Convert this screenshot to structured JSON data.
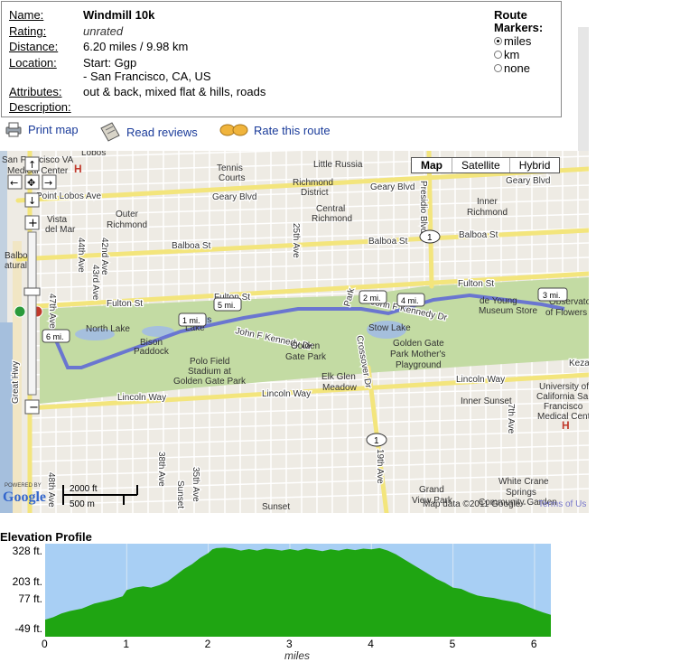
{
  "route": {
    "labels": {
      "name": "Name:",
      "rating": "Rating:",
      "distance": "Distance:",
      "location": "Location:",
      "attributes": "Attributes:",
      "description": "Description:"
    },
    "name": "Windmill 10k",
    "rating": "unrated",
    "distance": "6.20 miles / 9.98 km",
    "location_line1": "Start: Ggp",
    "location_line2": "- San Francisco, CA, US",
    "attributes": "out & back, mixed flat & hills, roads",
    "description": ""
  },
  "markers": {
    "title_line1": "Route",
    "title_line2": "Markers:",
    "options": [
      "miles",
      "km",
      "none"
    ],
    "selected": "miles"
  },
  "links": {
    "print_map": "Print map",
    "read_reviews": "Read reviews",
    "rate_route": "Rate this route"
  },
  "map": {
    "type_buttons": [
      "Map",
      "Satellite",
      "Hybrid"
    ],
    "active_type": "Map",
    "scale_ft": "2000 ft",
    "scale_m": "500 m",
    "powered_by": "POWERED BY",
    "google_logo": "Google",
    "copyright": "Map data ©2011 Google -",
    "terms": "Terms of Us",
    "mile_markers": [
      "1 mi.",
      "2 mi.",
      "3 mi.",
      "4 mi.",
      "5 mi.",
      "6 mi."
    ],
    "streets": {
      "geary1": "Geary Blvd",
      "geary2": "Geary Blvd",
      "geary3": "Geary Blvd",
      "point_lobos": "Point Lobos Ave",
      "balboa1": "Balboa St",
      "balboa2": "Balboa St",
      "balboa3": "Balboa St",
      "fulton1": "Fulton St",
      "fulton2": "Fulton St",
      "fulton3": "Fulton St",
      "lincoln1": "Lincoln Way",
      "lincoln2": "Lincoln Way",
      "lincoln3": "Lincoln Way",
      "jfk": "John F Kennedy Dr",
      "jfk2": "John F Kennedy Dr",
      "ave25": "25th Ave",
      "ave19": "19th Ave",
      "ave7": "7th Ave",
      "ave38": "38th Ave",
      "ave35": "35th Ave",
      "ave42": "42nd Ave",
      "ave43": "43rd Ave",
      "ave44": "44th Ave",
      "ave47": "47th Ave",
      "ave48": "48th Ave",
      "sunset_blvd": "Sunset",
      "crossover": "Crossover Dr",
      "presidio": "Presidio Blvd",
      "park": "Park",
      "great_hwy": "Great Hwy",
      "kezar": "Kezar"
    },
    "places": {
      "sf_va": "San Francisco VA",
      "medical_center": "Medical Center",
      "lobos": "Lobos",
      "tennis": "Tennis",
      "courts": "Courts",
      "little_russia": "Little Russia",
      "richmond": "Richmond",
      "district": "District",
      "outer": "Outer",
      "outer_richmond": "Richmond",
      "central": "Central",
      "central_richmond": "Richmond",
      "inner": "Inner",
      "inner_richmond": "Richmond",
      "vista1": "Vista",
      "vista2": "del Mar",
      "balboa_nat1": "Balboa",
      "balboa_nat2": "atural A",
      "north_lake": "North Lake",
      "bison1": "Bison",
      "bison2": "Paddock",
      "polo1": "Polo Field",
      "polo2": "Stadium at",
      "polo3": "Golden Gate Park",
      "ggp1": "Golden",
      "ggp2": "Gate Park",
      "elk1": "Elk Glen",
      "elk2": "Meadow",
      "stow_lake": "Stow Lake",
      "de_young1": "de Young",
      "de_young2": "Museum Store",
      "observatory1": "Observato",
      "observatory2": "of Flowers",
      "ggp_mother1": "Golden Gate",
      "ggp_mother2": "Park Mother's",
      "ggp_mother3": "Playground",
      "inner_sunset": "Inner Sunset",
      "ucsf1": "University of",
      "ucsf2": "California Sa",
      "ucsf3": "Francisco",
      "ucsf4": "Medical Cent",
      "sunset": "Sunset",
      "grand1": "Grand",
      "grand2": "View Park",
      "white_crane1": "White Crane",
      "white_crane2": "Springs",
      "garden": "Community Garden",
      "lake": "Lake",
      "is_label": "ls"
    },
    "highway_shield": "1"
  },
  "elevation": {
    "title": "Elevation Profile",
    "y_ticks": [
      "328 ft.",
      "203 ft.",
      "77 ft.",
      "-49 ft."
    ],
    "x_ticks": [
      "0",
      "1",
      "2",
      "3",
      "4",
      "5",
      "6"
    ],
    "x_label": "miles",
    "colors": {
      "sky": "#a8cff4",
      "fill": "#1fa512"
    },
    "profile_ft": [
      [
        0.0,
        20
      ],
      [
        0.1,
        30
      ],
      [
        0.2,
        45
      ],
      [
        0.3,
        55
      ],
      [
        0.45,
        65
      ],
      [
        0.6,
        85
      ],
      [
        0.8,
        100
      ],
      [
        0.95,
        115
      ],
      [
        1.0,
        140
      ],
      [
        1.1,
        150
      ],
      [
        1.2,
        155
      ],
      [
        1.3,
        150
      ],
      [
        1.4,
        160
      ],
      [
        1.5,
        175
      ],
      [
        1.6,
        200
      ],
      [
        1.7,
        225
      ],
      [
        1.8,
        245
      ],
      [
        1.9,
        270
      ],
      [
        2.0,
        290
      ],
      [
        2.05,
        305
      ],
      [
        2.1,
        310
      ],
      [
        2.2,
        312
      ],
      [
        2.3,
        308
      ],
      [
        2.4,
        300
      ],
      [
        2.5,
        306
      ],
      [
        2.6,
        300
      ],
      [
        2.7,
        308
      ],
      [
        2.8,
        305
      ],
      [
        2.9,
        300
      ],
      [
        3.0,
        306
      ],
      [
        3.1,
        300
      ],
      [
        3.2,
        308
      ],
      [
        3.3,
        303
      ],
      [
        3.4,
        298
      ],
      [
        3.5,
        305
      ],
      [
        3.6,
        300
      ],
      [
        3.7,
        307
      ],
      [
        3.8,
        302
      ],
      [
        3.9,
        308
      ],
      [
        4.0,
        305
      ],
      [
        4.1,
        310
      ],
      [
        4.2,
        300
      ],
      [
        4.3,
        285
      ],
      [
        4.4,
        265
      ],
      [
        4.5,
        245
      ],
      [
        4.6,
        225
      ],
      [
        4.7,
        205
      ],
      [
        4.8,
        185
      ],
      [
        4.9,
        170
      ],
      [
        5.0,
        150
      ],
      [
        5.1,
        145
      ],
      [
        5.2,
        130
      ],
      [
        5.3,
        118
      ],
      [
        5.4,
        112
      ],
      [
        5.5,
        108
      ],
      [
        5.6,
        100
      ],
      [
        5.7,
        95
      ],
      [
        5.8,
        88
      ],
      [
        5.9,
        75
      ],
      [
        6.0,
        62
      ],
      [
        6.1,
        50
      ],
      [
        6.2,
        40
      ]
    ],
    "ylim": [
      -49,
      328
    ],
    "xlim": [
      0,
      6.2
    ]
  }
}
